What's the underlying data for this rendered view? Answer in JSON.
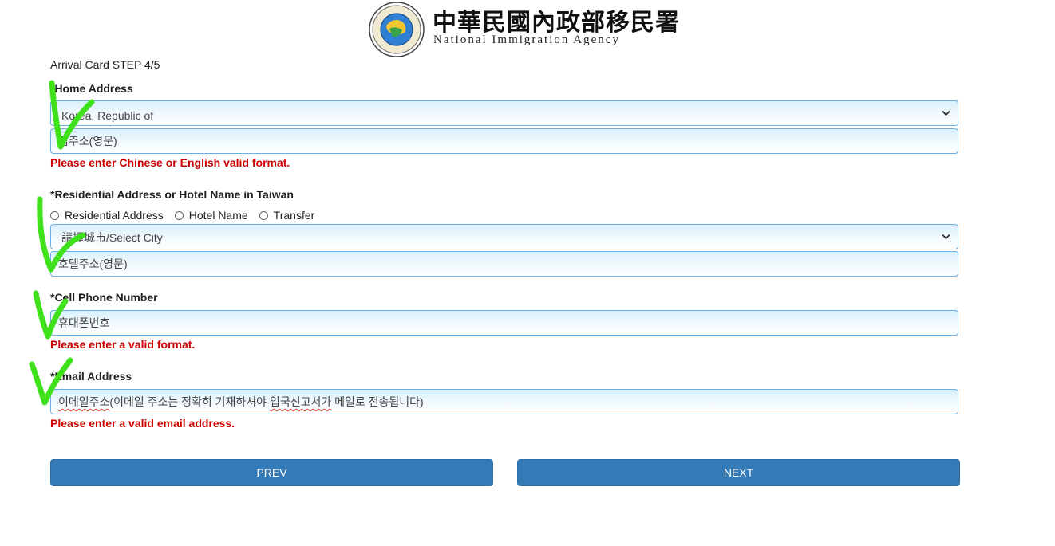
{
  "header": {
    "agency_name_zh": "中華民國內政部移民署",
    "agency_name_en": "National Immigration Agency"
  },
  "form": {
    "step": "Arrival Card STEP 4/5",
    "home_address": {
      "label": "*Home Address",
      "country_value": "Korea, Republic of",
      "address_placeholder": "집주소(영문)",
      "error": "Please enter Chinese or English valid format."
    },
    "taiwan_address": {
      "label": "*Residential Address or Hotel Name in Taiwan",
      "options": [
        "Residential Address",
        "Hotel Name",
        "Transfer"
      ],
      "city_value": "請擇城市/Select City",
      "address_placeholder": "호텔주소(영문)"
    },
    "cell_phone": {
      "label": "*Cell Phone Number",
      "placeholder": "휴대폰번호",
      "error": "Please enter a valid format."
    },
    "email": {
      "label": "*Email Address",
      "placeholder_underlined": "이메일주소",
      "placeholder_rest": "(이메일 주소는 정확히 기재하셔야 ",
      "placeholder_underlined_2": "입국신고서가",
      "placeholder_end": " 메일로 전송됩니다)",
      "error": "Please enter a valid email address."
    }
  },
  "buttons": {
    "prev": "PREV",
    "next": "NEXT"
  },
  "colors": {
    "button": "#337ab7",
    "error": "#cc0000",
    "field_border": "#66afe9",
    "check_mark": "#3fe11b"
  }
}
